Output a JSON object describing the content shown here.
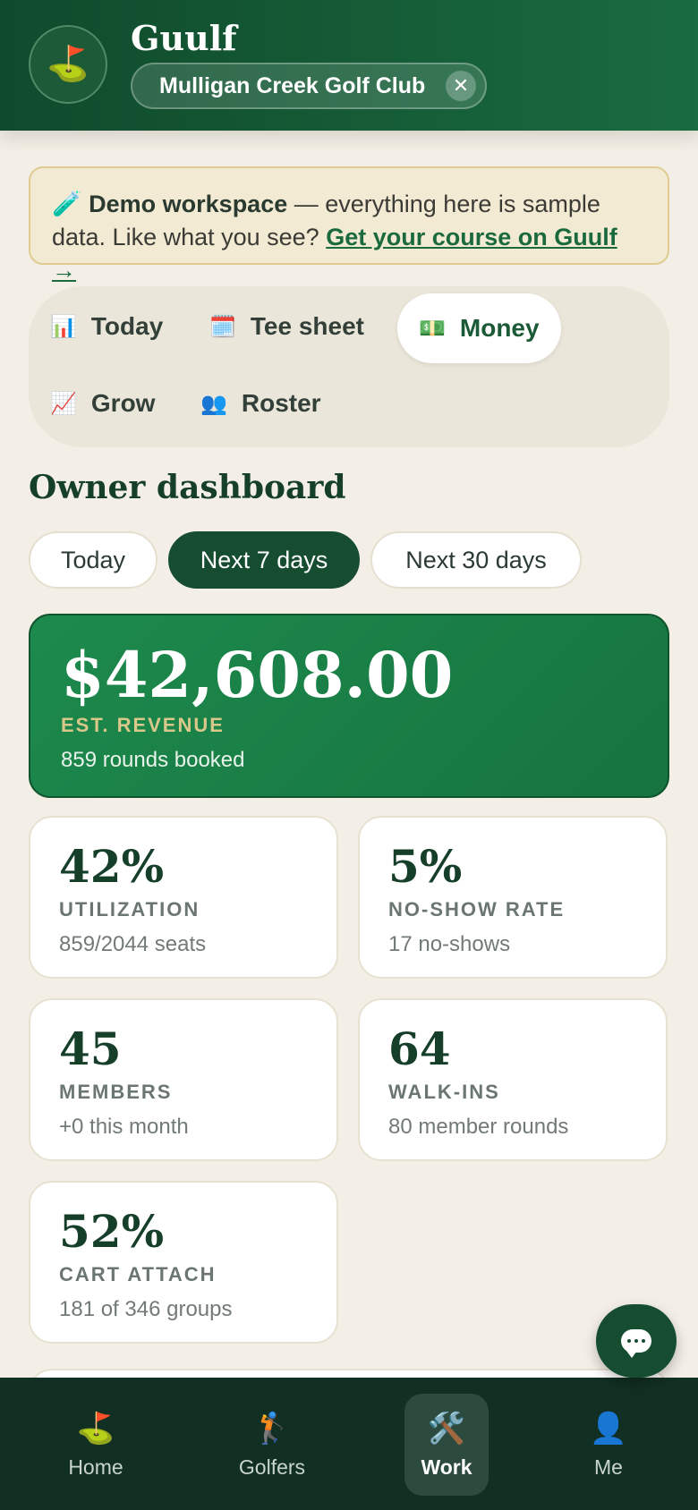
{
  "header": {
    "logo_icon": "flag-in-hole-icon",
    "brand": "Guulf",
    "course_name": "Mulligan Creek Golf Club",
    "close_glyph": "✕"
  },
  "banner": {
    "icon": "test-tube-icon",
    "bold": "Demo workspace",
    "text": " — everything here is sample data. Like what you see? ",
    "cta": "Get your course on Guulf →"
  },
  "nav": {
    "items": [
      {
        "icon": "bar-chart-icon",
        "label": "Today",
        "active": false
      },
      {
        "icon": "calendar-icon",
        "label": "Tee sheet",
        "active": false
      },
      {
        "icon": "money-icon",
        "label": "Money",
        "active": true
      },
      {
        "icon": "trend-up-icon",
        "label": "Grow",
        "active": false
      },
      {
        "icon": "people-icon",
        "label": "Roster",
        "active": false
      }
    ]
  },
  "dashboard": {
    "title": "Owner dashboard",
    "ranges": [
      "Today",
      "Next 7 days",
      "Next 30 days"
    ],
    "active_range": "Next 7 days",
    "revenue": {
      "amount": "$42,608.00",
      "label": "EST. REVENUE",
      "sub": "859 rounds booked"
    },
    "stats": [
      {
        "value": "42%",
        "label": "UTILIZATION",
        "sub": "859/2044 seats"
      },
      {
        "value": "5%",
        "label": "NO-SHOW RATE",
        "sub": "17 no-shows"
      },
      {
        "value": "45",
        "label": "MEMBERS",
        "sub": "+0 this month"
      },
      {
        "value": "64",
        "label": "WALK-INS",
        "sub": "80 member rounds"
      },
      {
        "value": "52%",
        "label": "CART ATTACH",
        "sub": "181 of 346 groups"
      }
    ]
  },
  "tabbar": {
    "items": [
      {
        "icon": "flag-in-hole-icon",
        "label": "Home",
        "active": false
      },
      {
        "icon": "golfer-icon",
        "label": "Golfers",
        "active": false
      },
      {
        "icon": "tools-icon",
        "label": "Work",
        "active": true
      },
      {
        "icon": "person-icon",
        "label": "Me",
        "active": false
      }
    ]
  },
  "colors": {
    "brand_green": "#164d31",
    "revenue_card": "#1d8a4d",
    "accent_gold": "#d9c88a",
    "background": "#f3efe6"
  }
}
